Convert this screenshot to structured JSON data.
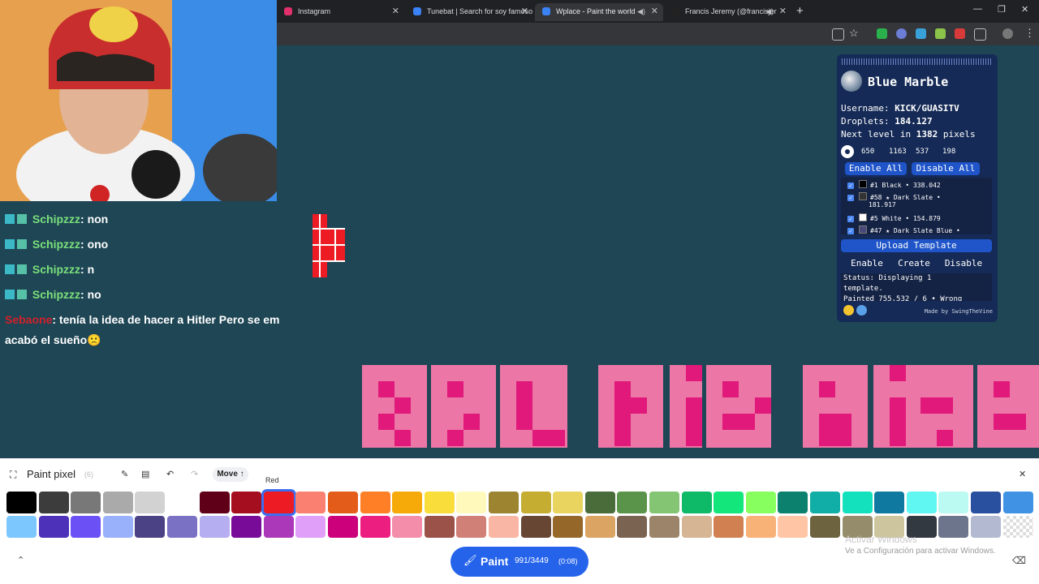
{
  "browser": {
    "tabs": [
      {
        "title": "Instagram",
        "favicon_color": "#e1306c",
        "active": false
      },
      {
        "title": "Tunebat | Search for soy famoso",
        "favicon_color": "#3b82f6",
        "active": false
      },
      {
        "title": "Wplace - Paint the world",
        "favicon_color": "#3b82f6",
        "active": true
      },
      {
        "title": "Francis Jeremy (@francisjer",
        "favicon_color": "#222222",
        "active": false
      }
    ]
  },
  "chat": {
    "lines": [
      {
        "user": "Schipzzz",
        "text": ": non"
      },
      {
        "user": "Schipzzz",
        "text": ": ono"
      },
      {
        "user": "Schipzzz",
        "text": ": n"
      },
      {
        "user": "Schipzzz",
        "text": ": no"
      },
      {
        "user": "Sebaone",
        "text": ": tenía la idea de hacer a Hitler Pero se em",
        "text2": "acabó el sueño🙁"
      }
    ]
  },
  "blue_marble": {
    "title": "Blue Marble",
    "username_label": "Username: ",
    "username": "KICK/GUASITV",
    "droplets_label": "Droplets: ",
    "droplets": "184.127",
    "next_level": "Next level in ",
    "next_level_pixels": "1382",
    "next_level_suffix": " pixels",
    "coords": [
      "650",
      "1163",
      "537",
      "198"
    ],
    "enable_all": "Enable All",
    "disable_all": "Disable All",
    "colors": [
      {
        "label": "#1 Black • 338.042",
        "swatch": "#000000"
      },
      {
        "label": "#58 ★ Dark Slate •",
        "label2": "181.917",
        "swatch": "#333333"
      },
      {
        "label": "#5 White • 154.879",
        "swatch": "#ffffff"
      },
      {
        "label": "#47 ★ Dark Slate Blue •",
        "swatch": "#4a4a7a"
      }
    ],
    "upload_template": "Upload Template",
    "enable": "Enable",
    "create": "Create",
    "disable": "Disable",
    "status": "Status: Displaying 1",
    "status2": "template.",
    "status3": "Painted 755,532 / 6 • Wrong",
    "made_by": "Made by SwingTheVine"
  },
  "canvas_text": "BRO HIS PIXE",
  "palette": {
    "title": "Paint pixel",
    "count": "(6)",
    "move": "Move",
    "tooltip": "Red",
    "row1": [
      "#000000",
      "#3c3c3c",
      "#787878",
      "#aaaaaa",
      "#d2d2d2",
      "#ffffff",
      "#600018",
      "#a50e1e",
      "#ed1c24",
      "#fa8072",
      "#e45c1a",
      "#ff7f27",
      "#f6aa09",
      "#f9dd3b",
      "#fffabc",
      "#9c8431",
      "#c5ad31",
      "#e8d45f",
      "#4a6b3a",
      "#5a944a",
      "#84c573",
      "#0eb968",
      "#13e67b",
      "#87ff5e",
      "#0c816e",
      "#10aea6",
      "#13e1be",
      "#0f799f",
      "#60f7f2",
      "#bbfaf2",
      "#28509e",
      "#4093e4"
    ],
    "row2": [
      "#7dc7ff",
      "#4d31b8",
      "#6b50f6",
      "#99b1fb",
      "#4a4284",
      "#7a71c4",
      "#b5aef1",
      "#780c99",
      "#aa38b9",
      "#e09ff9",
      "#cb007a",
      "#ec1f80",
      "#f38da9",
      "#9b5249",
      "#d18078",
      "#fab6a4",
      "#684634",
      "#95682a",
      "#dba463",
      "#7b6352",
      "#9c846b",
      "#d6b594",
      "#d18051",
      "#f8b277",
      "#ffc5a5",
      "#6d643f",
      "#948c6b",
      "#cdc59e",
      "#333941",
      "#6d758d",
      "#b3b9d1",
      "#transparent"
    ],
    "selected_index": 8,
    "paint_label": "Paint",
    "paint_count": "991/3449",
    "paint_timer": "(0:08)",
    "watermark1": "Activar Windows",
    "watermark2": "Ve a Configuración para activar Windows."
  }
}
